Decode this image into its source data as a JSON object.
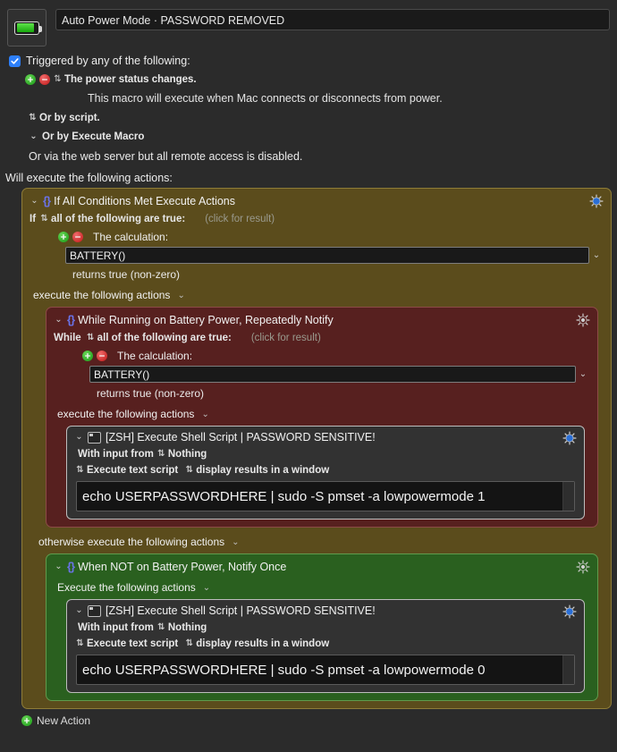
{
  "window": {
    "macro_icon": "battery-icon",
    "title_value": "Auto Power Mode · PASSWORD REMOVED"
  },
  "trigger": {
    "checkbox_label": "Triggered by any of the following:",
    "checkbox_checked": true,
    "trigger_text": "The power status changes.",
    "trigger_description": "This macro will execute when Mac connects or disconnects from power.",
    "or_script": "Or by script.",
    "or_execute_macro": "Or by Execute Macro",
    "or_web_server": "Or via the web server but all remote access is disabled."
  },
  "actions_header": "Will execute the following actions:",
  "if_block": {
    "title": "If All Conditions Met Execute Actions",
    "if_keyword": "If",
    "condition_mode": "all of the following are true:",
    "result_hint": "(click for result)",
    "calculation_label": "The calculation:",
    "calculation_value": "BATTERY()",
    "returns_text": "returns true (non-zero)",
    "execute_label": "execute the following actions",
    "otherwise_label": "otherwise execute the following actions",
    "gear_color": "#2a6fd6"
  },
  "while_block": {
    "title": "While Running on Battery Power, Repeatedly Notify",
    "while_keyword": "While",
    "condition_mode": "all of the following are true:",
    "result_hint": "(click for result)",
    "calculation_label": "The calculation:",
    "calculation_value": "BATTERY()",
    "returns_text": "returns true (non-zero)",
    "execute_label": "execute the following actions",
    "gear_color": "#c9c9c9"
  },
  "shell_battery": {
    "title": "[ZSH] Execute Shell Script | PASSWORD SENSITIVE!",
    "input_label": "With input from",
    "input_value": "Nothing",
    "script_type": "Execute text script",
    "output_mode": "display results in a window",
    "script": "echo USERPASSWORDHERE | sudo -S pmset -a lowpowermode 1",
    "gear_color": "#2a6fd6"
  },
  "green_block": {
    "title": "When NOT on Battery Power, Notify Once",
    "execute_label": "Execute the following actions",
    "gear_color": "#c9c9c9"
  },
  "shell_ac": {
    "title": "[ZSH] Execute Shell Script | PASSWORD SENSITIVE!",
    "input_label": "With input from",
    "input_value": "Nothing",
    "script_type": "Execute text script",
    "output_mode": "display results in a window",
    "script": "echo USERPASSWORDHERE | sudo -S pmset -a lowpowermode 0",
    "gear_color": "#2a6fd6"
  },
  "footer": {
    "new_action_label": "New Action"
  },
  "glyphs": {
    "stepper": "⇅",
    "chevron_down": "⌄",
    "braces": "{}",
    "plus_circle": "+",
    "minus_circle": "−"
  },
  "colors": {
    "background": "#2b2b2b",
    "if_block": "#5b4c1c",
    "while_block": "#57201f",
    "green_block": "#2a601f",
    "shell_block": "#323232",
    "accent_blue": "#2d7ff9",
    "braces_blue": "#6a73e8"
  }
}
